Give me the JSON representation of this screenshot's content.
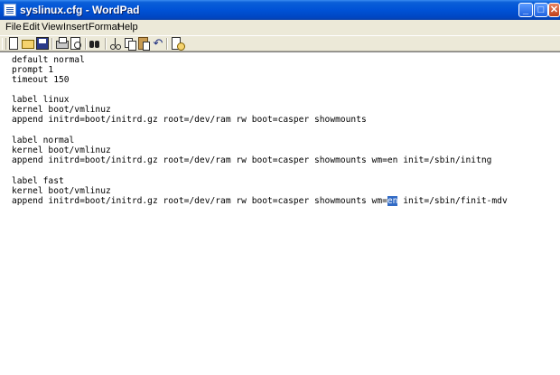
{
  "window": {
    "title": "syslinux.cfg - WordPad",
    "min_glyph": "_",
    "max_glyph": "□",
    "close_glyph": "✕"
  },
  "menu": {
    "items": [
      "File",
      "Edit",
      "View",
      "Insert",
      "Format",
      "Help"
    ]
  },
  "toolbar": {
    "undo_glyph": "↶"
  },
  "document": {
    "lines": [
      "default normal",
      "prompt 1",
      "timeout 150",
      "",
      "label linux",
      "kernel boot/vmlinuz",
      "append initrd=boot/initrd.gz root=/dev/ram rw boot=casper showmounts",
      "",
      "label normal",
      "kernel boot/vmlinuz",
      "append initrd=boot/initrd.gz root=/dev/ram rw boot=casper showmounts wm=en init=/sbin/initng",
      "",
      "label fast",
      "kernel boot/vmlinuz",
      "append initrd=boot/initrd.gz root=/dev/ram rw boot=casper showmounts wm="
    ],
    "last_line_selected": "en",
    "last_line_rest": " init=/sbin/finit-mdv"
  },
  "colors": {
    "titlebar": "#0052d6",
    "selection": "#316ac5",
    "chrome": "#ece9d8"
  }
}
